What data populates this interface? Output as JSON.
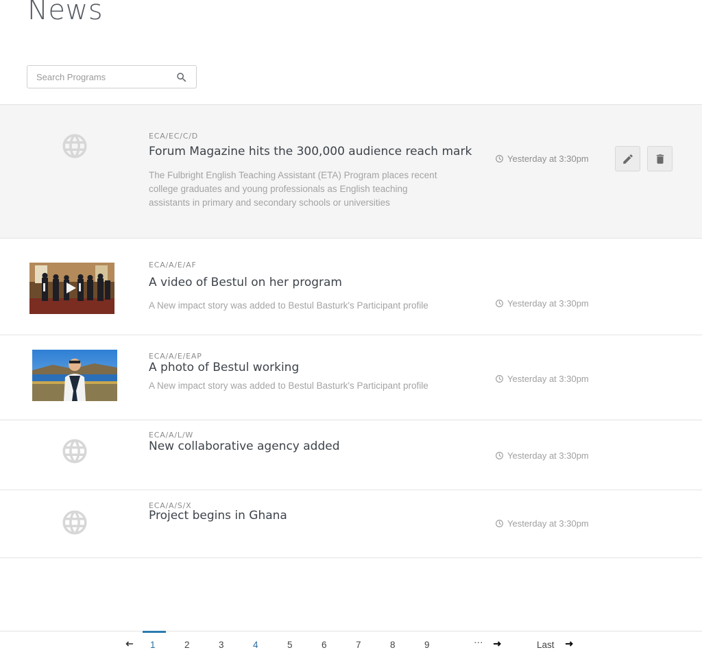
{
  "page": {
    "title": "News"
  },
  "search": {
    "placeholder": "Search Programs"
  },
  "items": [
    {
      "code": "ECA/EC/C/D",
      "title": "Forum Magazine hits the 300,000 audience reach mark",
      "description": "The Fulbright English Teaching Assistant (ETA) Program places recent college graduates and young professionals as English teaching assistants in primary and secondary schools or universities",
      "time": "Yesterday at 3:30pm",
      "thumb": "globe-icon"
    },
    {
      "code": "ECA/A/E/AF",
      "title": "A video of Bestul on her program",
      "description": "A New impact story was added to Bestul Basturk's Participant profile",
      "time": "Yesterday at 3:30pm",
      "thumb": "video-thumbnail"
    },
    {
      "code": "ECA/A/E/EAP",
      "title": "A photo of Bestul working",
      "description": "A New impact story was added to Bestul Basturk's Participant profile",
      "time": "Yesterday at 3:30pm",
      "thumb": "photo-thumbnail"
    },
    {
      "code": "ECA/A/L/W",
      "title": "New collaborative agency added",
      "time": "Yesterday at 3:30pm",
      "thumb": "globe-icon"
    },
    {
      "code": "ECA/A/S/X",
      "title": "Project begins in Ghana",
      "time": "Yesterday at 3:30pm",
      "thumb": "globe-icon"
    }
  ],
  "pagination": {
    "prev_icon": "arrow-left-icon",
    "pages": [
      "1",
      "2",
      "3",
      "4",
      "5",
      "6",
      "7",
      "8",
      "9"
    ],
    "current": "1",
    "visited": "4",
    "ellipsis": "···",
    "next_icon": "arrow-right-icon",
    "last_label": "Last"
  },
  "colors": {
    "accent": "#2b7bb0",
    "highlight_row": "#f5f5f5",
    "title_text": "#3d434a"
  }
}
